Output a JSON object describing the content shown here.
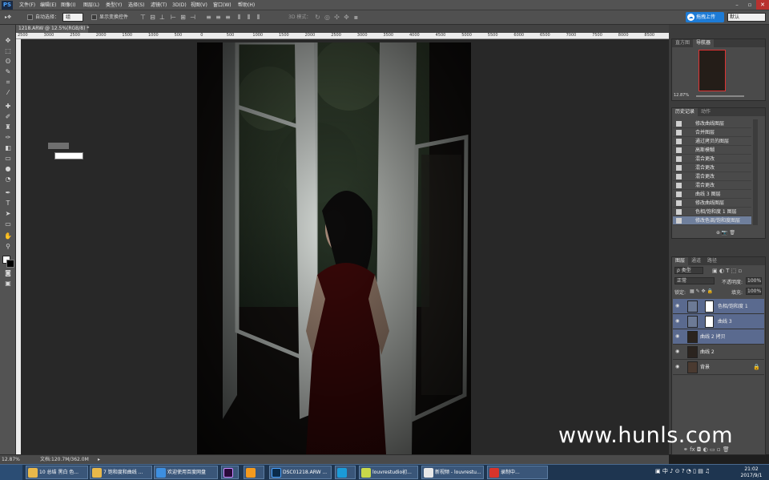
{
  "app": {
    "logo": "PS"
  },
  "menu": [
    "文件(F)",
    "编辑(E)",
    "图像(I)",
    "图层(L)",
    "类型(Y)",
    "选择(S)",
    "滤镜(T)",
    "3D(D)",
    "视图(V)",
    "窗口(W)",
    "帮助(H)"
  ],
  "options": {
    "auto_select_label": "自动选择：",
    "auto_select_value": "组",
    "show_transform_label": "显示变换控件",
    "mode_3d_label": "3D 模式：",
    "upload_label": "拖拽上传",
    "workspace_value": "默认"
  },
  "document": {
    "tab_label": "1218.ARW @ 12.5%(RGB/8) *",
    "ruler_ticks": [
      "2500",
      "3000",
      "2500",
      "2000",
      "1500",
      "1000",
      "500",
      "0",
      "500",
      "1000",
      "1500",
      "2000",
      "2500",
      "3000",
      "3500",
      "4000",
      "4500",
      "5000",
      "5500",
      "6000",
      "6500",
      "7000",
      "7500",
      "8000",
      "8500"
    ]
  },
  "status": {
    "zoom": "12.87%",
    "doc_info": "文档:120.7M/362.0M"
  },
  "navigator": {
    "tabs": [
      "直方图",
      "导航器"
    ],
    "zoom": "12.87%"
  },
  "history": {
    "tabs": [
      "历史记录",
      "动作"
    ],
    "items": [
      "修改曲线图层",
      "合并图层",
      "通过拷贝的图层",
      "高斯模糊",
      "混合更改",
      "混合更改",
      "混合更改",
      "混合更改",
      "曲线 3 图层",
      "修改曲线图层",
      "色相/饱和度 1 图层",
      "修改色调/饱和度图层"
    ]
  },
  "layers": {
    "tabs": [
      "图层",
      "通道",
      "路径"
    ],
    "filter_label": "ρ 类型",
    "blend_mode": "正常",
    "opacity_label": "不透明度:",
    "opacity_value": "100%",
    "lock_label": "锁定:",
    "fill_label": "填充:",
    "fill_value": "100%",
    "items": [
      {
        "name": "色相/饱和度 1"
      },
      {
        "name": "曲线 3"
      },
      {
        "name": "曲线 2 拷贝"
      },
      {
        "name": "曲线 2"
      },
      {
        "name": "背景"
      }
    ]
  },
  "taskbar": {
    "items": [
      "10 总结 黑白 色...",
      "7 饱和度和曲线 ...",
      "欢迎使用百度网盘",
      "",
      "",
      "DSC01218.ARW ...",
      "",
      "louvrestudio初...",
      "新视频 - louvrestu...",
      "录制中..."
    ],
    "time": "21:02",
    "date": "2017/9/1"
  },
  "watermark": "www.hunls.com"
}
